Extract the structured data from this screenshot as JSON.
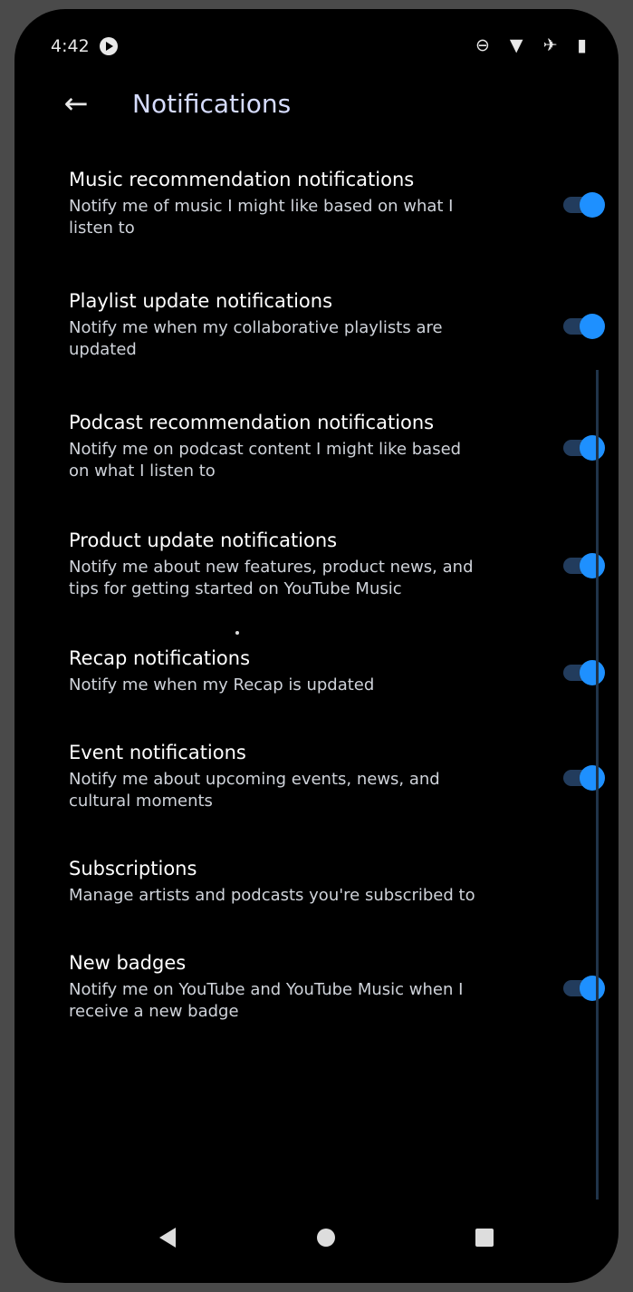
{
  "status_bar": {
    "time": "4:42",
    "right_icons_text": "⊖ ▼ ✈ ▮"
  },
  "appbar": {
    "title": "Notifications"
  },
  "items": [
    {
      "title": "Music recommendation notifications",
      "subtitle": "Notify me of music I might like based on what I listen to",
      "switch_on": true
    },
    {
      "title": "Playlist update notifications",
      "subtitle": "Notify me when my collaborative playlists are updated",
      "switch_on": true
    },
    {
      "title": "Podcast recommendation notifications",
      "subtitle": "Notify me on podcast content I might like based on what I listen to",
      "switch_on": true
    },
    {
      "title": "Product update notifications",
      "subtitle": "Notify me about new features, product news, and tips for getting started on YouTube Music",
      "switch_on": true
    },
    {
      "title": "Recap notifications",
      "subtitle": "Notify me when my Recap is updated",
      "switch_on": true
    },
    {
      "title": "Event notifications",
      "subtitle": "Notify me about upcoming events, news, and cultural moments",
      "switch_on": true
    },
    {
      "title": "Subscriptions",
      "subtitle": "Manage artists and podcasts you're subscribed to",
      "switch_on": null
    },
    {
      "title": "New badges",
      "subtitle": "Notify me on YouTube and YouTube Music when I receive a new badge",
      "switch_on": true
    }
  ],
  "colors": {
    "background": "#000000",
    "accent": "#1e90ff",
    "title": "#d6dcff"
  },
  "icons": {
    "back": "back-arrow-icon",
    "nav_back": "back-triangle-icon",
    "nav_home": "home-circle-icon",
    "nav_recent": "recent-square-icon"
  }
}
